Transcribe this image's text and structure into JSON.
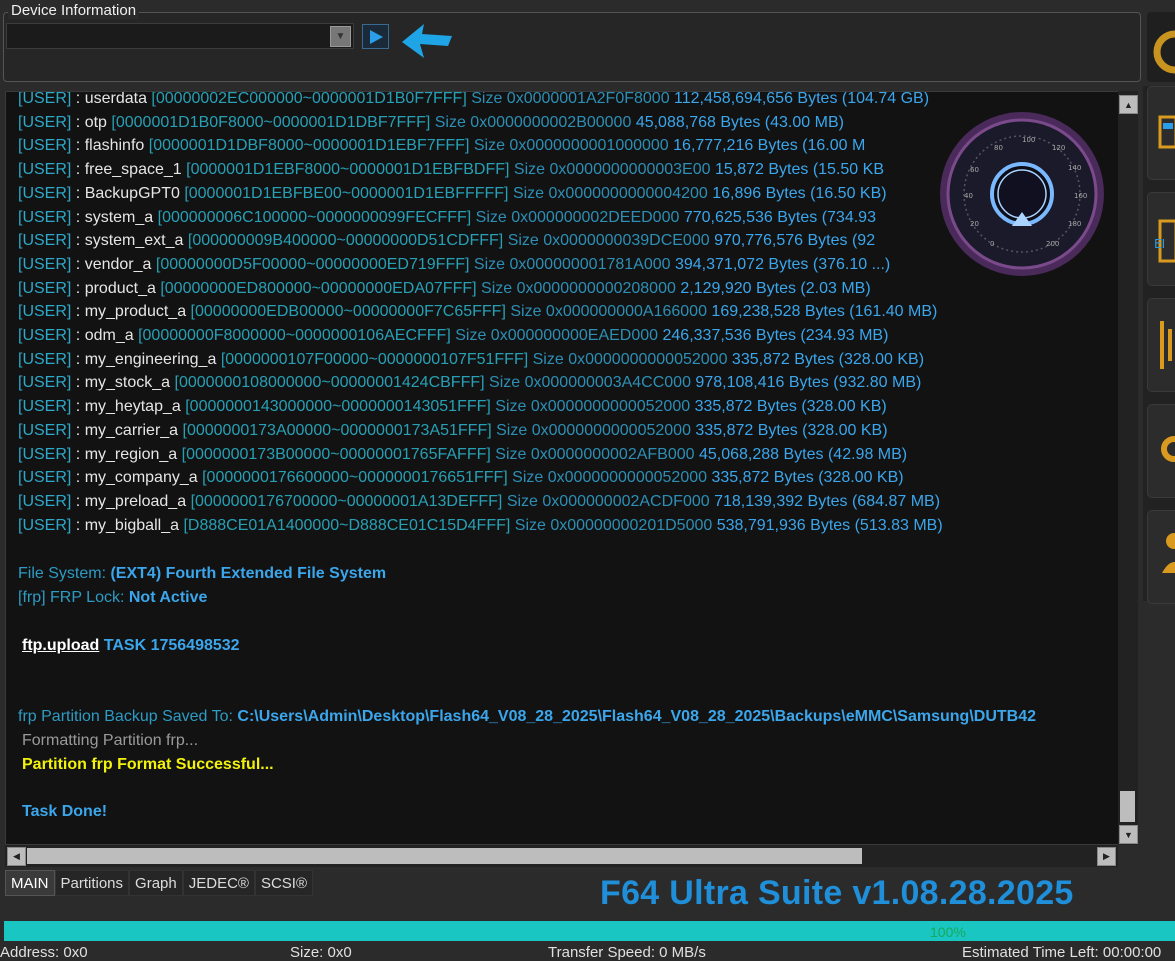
{
  "device_info": {
    "title": "Device Information",
    "combo_value": ""
  },
  "log": {
    "partitions": [
      {
        "tag": "[USER]",
        "name": "userdata",
        "range": "[00000002EC000000~0000001D1B0F7FFF]",
        "size": "Size 0x0000001A2F0F8000",
        "bytes": "112,458,694,656 Bytes (104.74 GB)"
      },
      {
        "tag": "[USER]",
        "name": "otp",
        "range": "[0000001D1B0F8000~0000001D1DBF7FFF]",
        "size": "Size 0x0000000002B00000",
        "bytes": "45,088,768 Bytes (43.00 MB)"
      },
      {
        "tag": "[USER]",
        "name": "flashinfo",
        "range": "[0000001D1DBF8000~0000001D1EBF7FFF]",
        "size": "Size 0x0000000001000000",
        "bytes": "16,777,216 Bytes (16.00 M"
      },
      {
        "tag": "[USER]",
        "name": "free_space_1",
        "range": "[0000001D1EBF8000~0000001D1EBFBDFF]",
        "size": "Size 0x0000000000003E00",
        "bytes": "15,872 Bytes (15.50 KB"
      },
      {
        "tag": "[USER]",
        "name": "BackupGPT0",
        "range": "[0000001D1EBFBE00~0000001D1EBFFFFF]",
        "size": "Size 0x0000000000004200",
        "bytes": "16,896 Bytes (16.50 KB)"
      },
      {
        "tag": "[USER]",
        "name": "system_a",
        "range": "[000000006C100000~0000000099FECFFF]",
        "size": "Size 0x000000002DEED000",
        "bytes": "770,625,536 Bytes (734.93"
      },
      {
        "tag": "[USER]",
        "name": "system_ext_a",
        "range": "[000000009B400000~00000000D51CDFFF]",
        "size": "Size 0x0000000039DCE000",
        "bytes": "970,776,576 Bytes (92"
      },
      {
        "tag": "[USER]",
        "name": "vendor_a",
        "range": "[00000000D5F00000~00000000ED719FFF]",
        "size": "Size 0x000000001781A000",
        "bytes": "394,371,072 Bytes (376.10 ...)"
      },
      {
        "tag": "[USER]",
        "name": "product_a",
        "range": "[00000000ED800000~00000000EDA07FFF]",
        "size": "Size 0x0000000000208000",
        "bytes": "2,129,920 Bytes (2.03 MB)"
      },
      {
        "tag": "[USER]",
        "name": "my_product_a",
        "range": "[00000000EDB00000~00000000F7C65FFF]",
        "size": "Size 0x000000000A166000",
        "bytes": "169,238,528 Bytes (161.40 MB)"
      },
      {
        "tag": "[USER]",
        "name": "odm_a",
        "range": "[00000000F8000000~0000000106AECFFF]",
        "size": "Size 0x000000000EAED000",
        "bytes": "246,337,536 Bytes (234.93 MB)"
      },
      {
        "tag": "[USER]",
        "name": "my_engineering_a",
        "range": "[0000000107F00000~0000000107F51FFF]",
        "size": "Size 0x0000000000052000",
        "bytes": "335,872 Bytes (328.00 KB)"
      },
      {
        "tag": "[USER]",
        "name": "my_stock_a",
        "range": "[0000000108000000~00000001424CBFFF]",
        "size": "Size 0x000000003A4CC000",
        "bytes": "978,108,416 Bytes (932.80 MB)"
      },
      {
        "tag": "[USER]",
        "name": "my_heytap_a",
        "range": "[0000000143000000~0000000143051FFF]",
        "size": "Size 0x0000000000052000",
        "bytes": "335,872 Bytes (328.00 KB)"
      },
      {
        "tag": "[USER]",
        "name": "my_carrier_a",
        "range": "[0000000173A00000~0000000173A51FFF]",
        "size": "Size 0x0000000000052000",
        "bytes": "335,872 Bytes (328.00 KB)"
      },
      {
        "tag": "[USER]",
        "name": "my_region_a",
        "range": "[0000000173B00000~00000001765FAFFF]",
        "size": "Size 0x0000000002AFB000",
        "bytes": "45,068,288 Bytes (42.98 MB)"
      },
      {
        "tag": "[USER]",
        "name": "my_company_a",
        "range": "[0000000176600000~0000000176651FFF]",
        "size": "Size 0x0000000000052000",
        "bytes": "335,872 Bytes (328.00 KB)"
      },
      {
        "tag": "[USER]",
        "name": "my_preload_a",
        "range": "[0000000176700000~00000001A13DEFFF]",
        "size": "Size 0x000000002ACDF000",
        "bytes": "718,139,392 Bytes (684.87 MB)"
      },
      {
        "tag": "[USER]",
        "name": "my_bigball_a",
        "range": "[D888CE01A1400000~D888CE01C15D4FFF]",
        "size": "Size 0x00000000201D5000",
        "bytes": "538,791,936 Bytes (513.83 MB)"
      }
    ],
    "separator": ":",
    "filesystem_label": "File System:",
    "filesystem_value": "(EXT4) Fourth Extended File System",
    "frp_label": "[frp] FRP Lock:",
    "frp_value": "Not Active",
    "ftp_cmd": "ftp.upload",
    "ftp_task": "TASK 1756498532",
    "backup_label": "frp Partition Backup Saved To:",
    "backup_path": "C:\\Users\\Admin\\Desktop\\Flash64_V08_28_2025\\Flash64_V08_28_2025\\Backups\\eMMC\\Samsung\\DUTB42",
    "formatting": "Formatting Partition frp...",
    "format_success": "Partition frp Format Successful...",
    "task_done": "Task Done!"
  },
  "tabs": [
    "MAIN",
    "Partitions",
    "Graph",
    "JEDEC®",
    "SCSI®"
  ],
  "active_tab": "MAIN",
  "brand": "F64 Ultra Suite v1.08.28.2025",
  "progress": {
    "value": 1.0,
    "label": "100%"
  },
  "status": {
    "address": "Address: 0x0",
    "size": "Size: 0x0",
    "transfer": "Transfer Speed: 0 MB/s",
    "eta": "Estimated Time Left: 00:00:00"
  },
  "colors": {
    "accent": "#1f8fd9",
    "progress": "#19c6c2",
    "success_yellow": "#f2f20c"
  }
}
